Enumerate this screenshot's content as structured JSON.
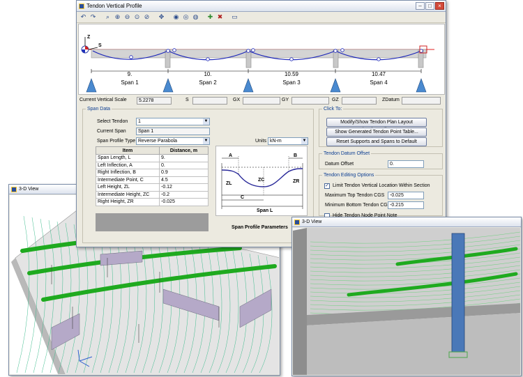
{
  "dialog": {
    "title": "Tendon Vertical Profile",
    "toolbar_icons": [
      "undo-icon",
      "redo-icon",
      "zoom-window-icon",
      "zoom-in-icon",
      "zoom-out-icon",
      "zoom-all-icon",
      "zoom-previous-icon",
      "pan-icon",
      "view-icon-1",
      "view-icon-2",
      "view-icon-3",
      "add-point-icon",
      "delete-point-icon",
      "options-icon"
    ],
    "spans": [
      {
        "label": "Span 1",
        "length": "9."
      },
      {
        "label": "Span 2",
        "length": "10."
      },
      {
        "label": "Span 3",
        "length": "10.59"
      },
      {
        "label": "Span 4",
        "length": "10.47"
      }
    ],
    "axis": {
      "z": "Z",
      "s": "S"
    },
    "info": {
      "scale_label": "Current Vertical Scale",
      "scale_value": "5.2278",
      "s_label": "S",
      "gx_label": "GX",
      "gy_label": "GY",
      "gz_label": "GZ",
      "zdatum_label": "ZDatum"
    },
    "span_data": {
      "legend": "Span Data",
      "select_tendon_label": "Select Tendon",
      "select_tendon_value": "1",
      "current_span_label": "Current Span",
      "current_span_value": "Span 1",
      "profile_type_label": "Span Profile Type",
      "profile_type_value": "Reverse Parabola",
      "units_label": "Units",
      "units_value": "kN-m",
      "table": {
        "col_item": "Item",
        "col_distance": "Distance,  m",
        "rows": [
          {
            "item": "Span Length, L",
            "value": "9."
          },
          {
            "item": "Left Inflection, A",
            "value": "0."
          },
          {
            "item": "Right Inflection, B",
            "value": "0.9"
          },
          {
            "item": "Intermediate Point, C",
            "value": "4.5"
          },
          {
            "item": "Left Height, ZL",
            "value": "-0.12"
          },
          {
            "item": "Intermediate Height, ZC",
            "value": "-0.2"
          },
          {
            "item": "Right Height, ZR",
            "value": "-0.025"
          }
        ]
      },
      "diagram": {
        "a": "A",
        "b": "B",
        "zl": "ZL",
        "zc": "ZC",
        "zr": "ZR",
        "c": "C",
        "span": "Span L"
      },
      "diagram_caption": "Span Profile Parameters"
    },
    "click_to": {
      "legend": "Click To:",
      "btn1": "Modify/Show Tendon Plan Layout (Horizontal)...",
      "btn2": "Show Generated Tendon Point Table...",
      "btn3": "Reset Supports and Spans to Default"
    },
    "datum": {
      "legend": "Tendon Datum Offset",
      "label": "Datum Offset",
      "value": "0."
    },
    "editing": {
      "legend": "Tendon Editing Options",
      "limit_label": "Limit Tendon Vertical Location Within Section",
      "max_label": "Maximum Top Tendon CGS",
      "max_value": "-0.025",
      "min_label": "Minimum Bottom Tendon CGS",
      "min_value": "-0.215",
      "hide_label": "Hide Tendon Node Point Note"
    }
  },
  "views": {
    "left_title": "3-D View",
    "right_title": "3-D View"
  },
  "colors": {
    "tendon": "#1faa1f",
    "profile": "#1a24b8",
    "support": "#4a8ad0",
    "beam": "#c8c8c8"
  }
}
